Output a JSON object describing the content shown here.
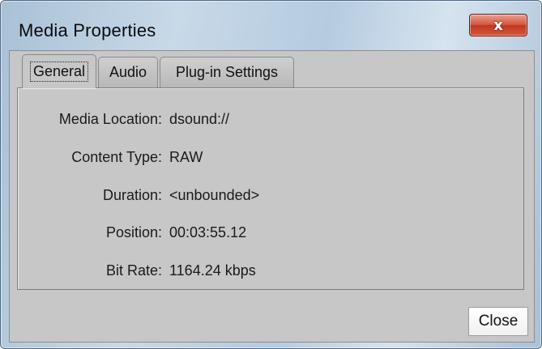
{
  "window": {
    "title": "Media Properties",
    "close_glyph": "x",
    "close_icon": "close-icon"
  },
  "tabs": [
    {
      "label": "General",
      "selected": true
    },
    {
      "label": "Audio",
      "selected": false
    },
    {
      "label": "Plug-in Settings",
      "selected": false
    }
  ],
  "general": {
    "rows": [
      {
        "label": "Media Location:",
        "value": "dsound://"
      },
      {
        "label": "Content Type:",
        "value": "RAW"
      },
      {
        "label": "Duration:",
        "value": "<unbounded>"
      },
      {
        "label": "Position:",
        "value": "00:03:55.12"
      },
      {
        "label": "Bit Rate:",
        "value": "1164.24 kbps"
      }
    ]
  },
  "footer": {
    "close_label": "Close"
  },
  "colors": {
    "close_button_red": "#d7543b",
    "panel_gray": "#c7c7c7",
    "titlebar_blue": "#b5cbe0"
  }
}
